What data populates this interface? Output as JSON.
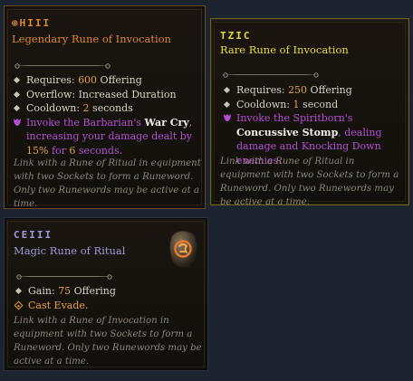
{
  "colors": {
    "legendary": "#d98a2e",
    "rare": "#e8dc3c",
    "magic": "#9f9bd9",
    "value": "#e8a23c",
    "affix": "#b24fd4"
  },
  "cards": [
    {
      "name": "⊕HIII",
      "subtitle": "Legendary Rune of Invocation",
      "stats": [
        {
          "label": "Requires: ",
          "value": "600",
          "suffix": " Offering"
        },
        {
          "label": "Overflow: Increased Duration"
        },
        {
          "label": "Cooldown: ",
          "value": "2",
          "suffix": " seconds"
        }
      ],
      "effect": {
        "pre": "Invoke the Barbarian's ",
        "skill": "War Cry",
        "mid": ", increasing your damage dealt by ",
        "v1": "15%",
        "mid2": " for ",
        "v2": "6",
        "post": " seconds."
      },
      "flavor": "Link with a Rune of Ritual in equipment with two Sockets to form a Runeword. Only two Runewords may be active at a time."
    },
    {
      "name": "TZIC",
      "subtitle": "Rare Rune of Invocation",
      "stats": [
        {
          "label": "Requires: ",
          "value": "250",
          "suffix": " Offering"
        },
        {
          "label": "Cooldown: ",
          "value": "1",
          "suffix": " second"
        }
      ],
      "effect": {
        "pre": "Invoke the Spiritborn's ",
        "skill": "Concussive Stomp",
        "post": ", dealing damage and Knocking Down enemies."
      },
      "flavor": "Link with a Rune of Ritual in equipment with two Sockets to form a Runeword. Only two Runewords may be active at a time."
    },
    {
      "name": "CEIII",
      "subtitle": "Magic Rune of Ritual",
      "icon": "rune-stone-icon",
      "stats": [
        {
          "label": "Gain: ",
          "value": "75",
          "suffix": " Offering"
        }
      ],
      "effect": {
        "text": "Cast Evade."
      },
      "flavor": "Link with a Rune of Invocation in equipment with two Sockets to form a Runeword. Only two Runewords may be active at a time."
    }
  ]
}
